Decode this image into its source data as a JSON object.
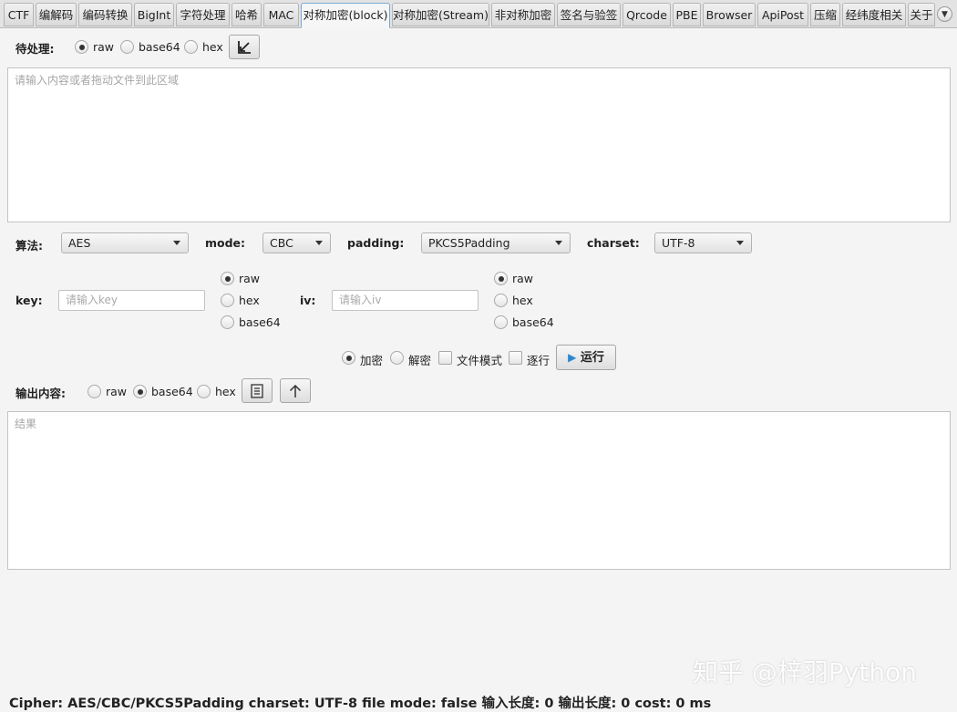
{
  "tabs": [
    {
      "label": "CTF"
    },
    {
      "label": "编解码"
    },
    {
      "label": "编码转换"
    },
    {
      "label": "BigInt"
    },
    {
      "label": "字符处理"
    },
    {
      "label": "哈希"
    },
    {
      "label": "MAC"
    },
    {
      "label": "对称加密(block)"
    },
    {
      "label": "对称加密(Stream)"
    },
    {
      "label": "非对称加密"
    },
    {
      "label": "签名与验签"
    },
    {
      "label": "Qrcode"
    },
    {
      "label": "PBE"
    },
    {
      "label": "Browser"
    },
    {
      "label": "ApiPost"
    },
    {
      "label": "压缩"
    },
    {
      "label": "经纬度相关"
    },
    {
      "label": "关于"
    }
  ],
  "active_tab": "对称加密(block)",
  "input": {
    "label": "待处理:",
    "formats": [
      "raw",
      "base64",
      "hex"
    ],
    "selected": "raw",
    "placeholder": "请输入内容或者拖动文件到此区域"
  },
  "algo": {
    "algorithm_label": "算法:",
    "algorithm_value": "AES",
    "mode_label": "mode:",
    "mode_value": "CBC",
    "padding_label": "padding:",
    "padding_value": "PKCS5Padding",
    "charset_label": "charset:",
    "charset_value": "UTF-8"
  },
  "key": {
    "label": "key:",
    "placeholder": "请输入key",
    "formats": [
      "raw",
      "hex",
      "base64"
    ],
    "selected": "raw"
  },
  "iv": {
    "label": "iv:",
    "placeholder": "请输入iv",
    "formats": [
      "raw",
      "hex",
      "base64"
    ],
    "selected": "raw"
  },
  "actions": {
    "encrypt": "加密",
    "decrypt": "解密",
    "file_mode": "文件模式",
    "line_by_line": "逐行",
    "run": "运行",
    "selected": "加密"
  },
  "output": {
    "label": "输出内容:",
    "formats": [
      "raw",
      "base64",
      "hex"
    ],
    "selected": "base64",
    "placeholder": "结果"
  },
  "status": "Cipher: AES/CBC/PKCS5Padding   charset: UTF-8  file mode:  false 输入长度: 0   输出长度: 0   cost: 0 ms",
  "watermark": "知乎 @梓羽Python"
}
